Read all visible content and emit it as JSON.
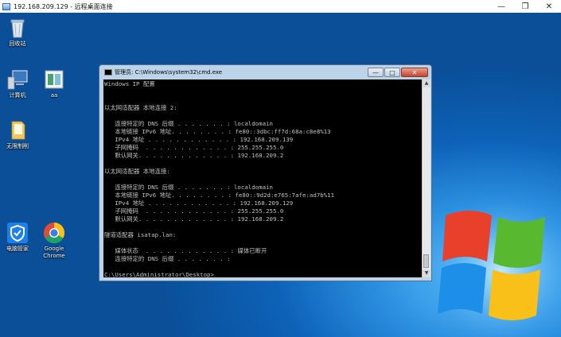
{
  "rdp": {
    "title": "192.168.209.129 - 远程桌面连接",
    "icon": "remote-desktop-icon",
    "controls": [
      "—",
      "❐",
      "✕"
    ]
  },
  "desktop": {
    "icons": [
      {
        "label": "回收站",
        "icon": "recycle-bin-icon"
      },
      {
        "label": "计算机",
        "icon": "computer-icon"
      },
      {
        "label": "aa",
        "icon": "file-icon"
      },
      {
        "label": "无限制削",
        "icon": "folder-icon"
      },
      {
        "label": "电脑管家",
        "icon": "pc-manager-icon"
      },
      {
        "label": "Google Chrome",
        "icon": "chrome-icon"
      }
    ]
  },
  "cmd": {
    "title": "管理员: C:\\Windows\\system32\\cmd.exe",
    "buttons": {
      "min": "—",
      "max": "□",
      "close": "✕"
    },
    "lines": [
      "Windows IP 配置",
      "",
      "",
      "以太网适配器 本地连接 2:",
      "",
      "   连接特定的 DNS 后缀 . . . . . . . : localdomain",
      "   本地链接 IPv6 地址. . . . . . . . : fe80::3dbc:ff7d:68a:c8e8%13",
      "   IPv4 地址 . . . . . . . . . . . . : 192.168.209.139",
      "   子网掩码  . . . . . . . . . . . . : 255.255.255.0",
      "   默认网关. . . . . . . . . . . . . : 192.168.209.2",
      "",
      "以太网适配器 本地连接:",
      "",
      "   连接特定的 DNS 后缀 . . . . . . . : localdomain",
      "   本地链接 IPv6 地址. . . . . . . . : fe80::9d2d:e765:7afe:ad7b%11",
      "   IPv4 地址 . . . . . . . . . . . . : 192.168.209.129",
      "   子网掩码  . . . . . . . . . . . . : 255.255.255.0",
      "   默认网关. . . . . . . . . . . . . : 192.168.209.2",
      "",
      "隧道适配器 isatap.lan:",
      "",
      "   媒体状态  . . . . . . . . . . . . : 媒体已断开",
      "   连接特定的 DNS 后缀 . . . . . . . :",
      "",
      "C:\\Users\\Administrator\\Desktop>"
    ]
  }
}
